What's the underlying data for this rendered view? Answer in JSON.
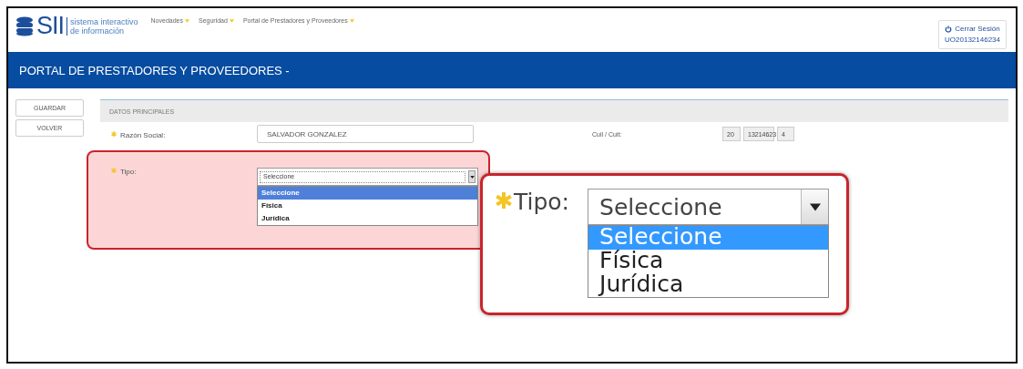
{
  "header": {
    "logo": {
      "mark": "SII",
      "tagline": [
        "sistema interactivo",
        "de información"
      ]
    },
    "nav": [
      {
        "label": "Novedades",
        "caret": true
      },
      {
        "label": "Seguridad",
        "caret": true
      },
      {
        "label": "Portal de Prestadores y Proveedores",
        "caret": true
      }
    ],
    "session": {
      "label": "Cerrar Sesión",
      "user": "UO20132146234"
    }
  },
  "banner": {
    "title": "PORTAL DE PRESTADORES Y PROVEEDORES -"
  },
  "actions": [
    "GUARDAR",
    "VOLVER"
  ],
  "section": {
    "title": "DATOS PRINCIPALES"
  },
  "razon_social": {
    "label": "Razón Social:",
    "required": true,
    "value": "SALVADOR GONZALEZ"
  },
  "cuil": {
    "label": "Cuil / Cuit:",
    "parts": [
      "20",
      "13214623",
      "4"
    ]
  },
  "tipo": {
    "label": "Tipo:",
    "required": true,
    "highlighted": true,
    "value": "Seleccione",
    "options": [
      {
        "label": "Seleccione",
        "selected": true
      },
      {
        "label": "Física",
        "selected": false
      },
      {
        "label": "Jurídica",
        "selected": false
      }
    ]
  },
  "callout": {
    "label": "Tipo:",
    "required": true,
    "value": "Seleccione",
    "options": [
      {
        "label": "Seleccione",
        "selected": true
      },
      {
        "label": "Física",
        "selected": false
      },
      {
        "label": "Jurídica",
        "selected": false
      }
    ]
  }
}
